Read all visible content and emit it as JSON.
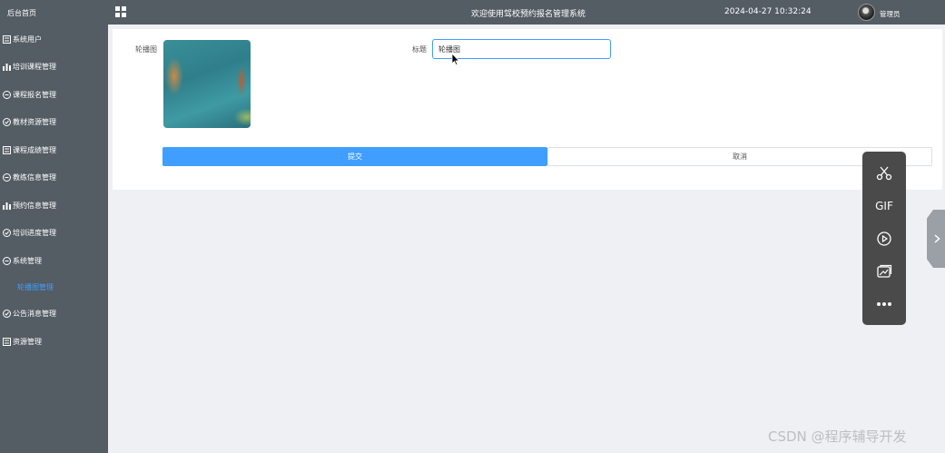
{
  "header": {
    "title": "欢迎使用驾校预约报名管理系统",
    "datetime": "2024-04-27 10:32:24",
    "user": "管理员"
  },
  "sidebar": {
    "home": "后台首页",
    "items": [
      {
        "label": "系统用户",
        "icon": "list-icon"
      },
      {
        "label": "培训课程管理",
        "icon": "bar-chart-icon"
      },
      {
        "label": "课程报名管理",
        "icon": "chat-icon"
      },
      {
        "label": "教材资源管理",
        "icon": "check-circle-icon"
      },
      {
        "label": "课程成绩管理",
        "icon": "list-icon"
      },
      {
        "label": "教练信息管理",
        "icon": "chat-icon"
      },
      {
        "label": "预约信息管理",
        "icon": "bar-chart-icon"
      },
      {
        "label": "培训进度管理",
        "icon": "check-circle-icon"
      },
      {
        "label": "系统管理",
        "icon": "chat-icon"
      }
    ],
    "active_sub": "轮播图管理",
    "items_after": [
      {
        "label": "公告消息管理",
        "icon": "check-circle-icon"
      },
      {
        "label": "资源管理",
        "icon": "list-icon"
      }
    ]
  },
  "form": {
    "image_label": "轮播图",
    "title_label": "标题",
    "title_value": "轮播图",
    "submit_label": "提交",
    "cancel_label": "取消"
  },
  "float_toolbar": {
    "gif_label": "GIF"
  },
  "watermark": "CSDN @程序辅导开发"
}
